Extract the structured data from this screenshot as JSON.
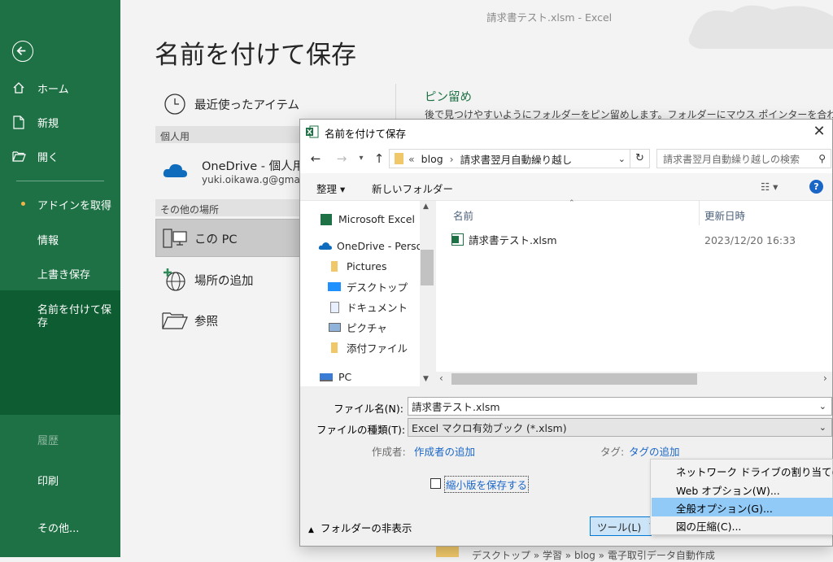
{
  "window": {
    "title": "請求書テスト.xlsm  -  Excel"
  },
  "nav": {
    "items": [
      "ホーム",
      "新規",
      "開く"
    ],
    "secondary": [
      "アドインを取得",
      "情報",
      "上書き保存",
      "名前を付けて保",
      "存"
    ],
    "history": "履歴",
    "print": "印刷",
    "more": "その他..."
  },
  "backstage": {
    "title": "名前を付けて保存",
    "recent": "最近使ったアイテム",
    "personal_header": "個人用",
    "onedrive_name": "OneDrive - 個人用",
    "onedrive_email": "yuki.oikawa.g@gmail.com",
    "other_header": "その他の場所",
    "this_pc": "この PC",
    "add_place": "場所の追加",
    "browse": "参照",
    "pin_title": "ピン留め",
    "pin_desc": "後で見つけやすいようにフォルダーをピン留めします。フォルダーにマウス ポインターを合わせたときに表示さ",
    "bottom_path": "デスクトップ » 学習 » blog » 電子取引データ自動作成"
  },
  "dialog": {
    "title": "名前を付けて保存",
    "close": "✕",
    "address": {
      "prefix": "«",
      "segments": [
        "blog",
        "請求書翌月自動繰り越し"
      ]
    },
    "search_placeholder": "請求書翌月自動繰り越しの検索",
    "toolbar": {
      "organize": "整理 ▾",
      "new_folder": "新しいフォルダー"
    },
    "tree": [
      "Microsoft Excel",
      "OneDrive - Personal",
      "Pictures",
      "デスクトップ",
      "ドキュメント",
      "ピクチャ",
      "添付ファイル",
      "PC"
    ],
    "columns": {
      "name": "名前",
      "date": "更新日時"
    },
    "files": [
      {
        "name": "請求書テスト.xlsm",
        "date": "2023/12/20 16:33"
      }
    ],
    "filename_label": "ファイル名(N):",
    "filename_value": "請求書テスト.xlsm",
    "filetype_label": "ファイルの種類(T):",
    "filetype_value": "Excel マクロ有効ブック (*.xlsm)",
    "author_label": "作成者:",
    "author_link": "作成者の追加",
    "tag_label": "タグ:",
    "tag_link": "タグの追加",
    "thumbnail_label": "縮小版を保存する",
    "hide_folders": "フォルダーの非表示",
    "tools": "ツール(L)"
  },
  "tools_menu": [
    "ネットワーク ドライブの割り当て(N)...",
    "Web オプション(W)...",
    "全般オプション(G)...",
    "図の圧縮(C)..."
  ],
  "colors": {
    "accent": "#1e7145",
    "selected_nav": "#0e5c32",
    "menu_highlight": "#91c9f7",
    "link": "#1a66c7"
  }
}
